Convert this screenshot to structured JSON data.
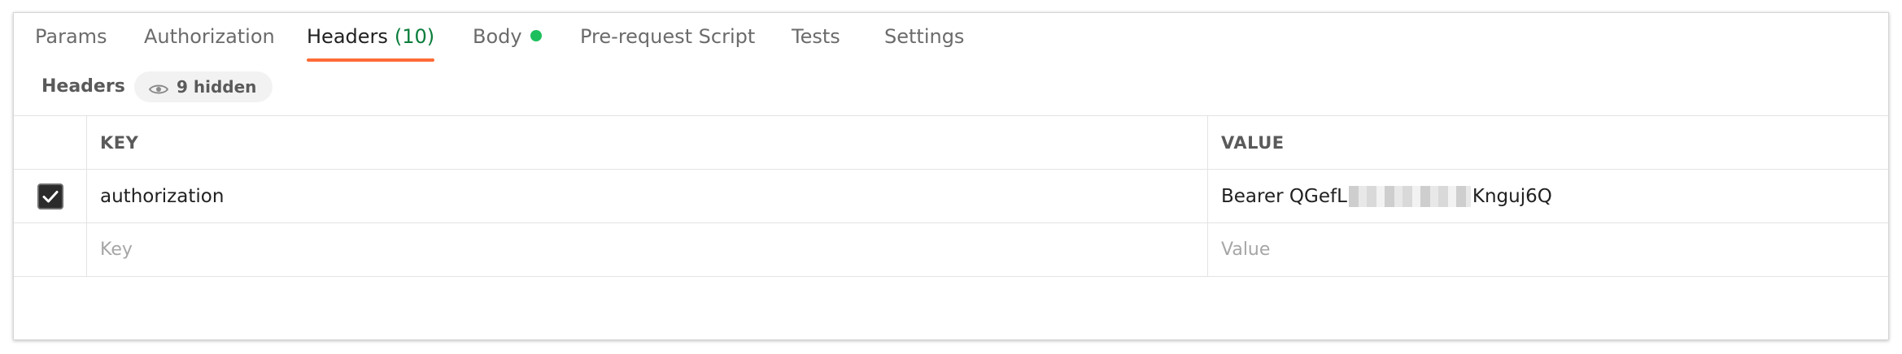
{
  "tabs": [
    {
      "label": "Params"
    },
    {
      "label": "Authorization"
    },
    {
      "label": "Headers",
      "count": "(10)"
    },
    {
      "label": "Body"
    },
    {
      "label": "Pre-request Script"
    },
    {
      "label": "Tests"
    },
    {
      "label": "Settings"
    }
  ],
  "active_tab": "Headers",
  "body_indicator_color": "#1dbf5d",
  "accent_color": "#ff6c37",
  "subheader": {
    "title": "Headers",
    "hidden_label": "9 hidden",
    "hidden_icon": "eye-icon"
  },
  "table": {
    "columns": [
      "KEY",
      "VALUE"
    ],
    "rows": [
      {
        "checked": true,
        "key": "authorization",
        "value_prefix": "Bearer QGefL",
        "value_suffix": "Knguj6Q"
      }
    ],
    "new_row": {
      "key_placeholder": "Key",
      "value_placeholder": "Value"
    }
  }
}
